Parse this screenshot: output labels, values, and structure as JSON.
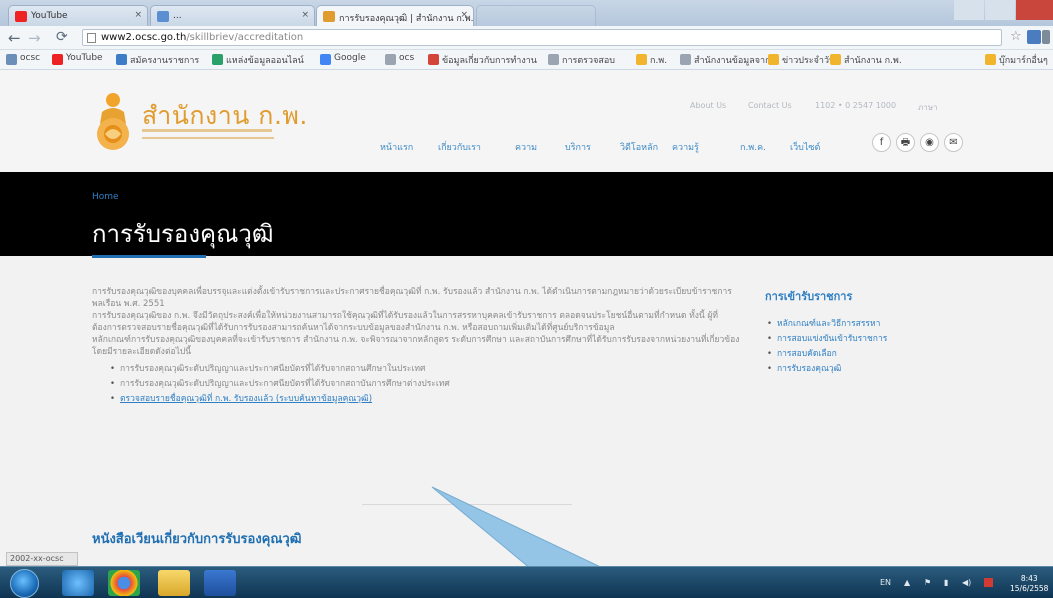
{
  "browser": {
    "tabs": [
      {
        "label": "YouTube",
        "active": false
      },
      {
        "label": "...",
        "active": false
      },
      {
        "label": "การรับรองคุณวุฒิ | สำนักงาน ก.พ.",
        "active": true
      },
      {
        "label": "",
        "active": false
      }
    ],
    "url_host": "www2.ocsc.go.th",
    "url_path": "/skillbriev/accreditation",
    "bookmarks": [
      "ocsc",
      "YouTube",
      "สมัครงานราชการ",
      "แหล่งข้อมูลออนไลน์",
      "Google",
      "ocs",
      "ข้อมูลเกี่ยวกับการทำงาน",
      "การตรวจสอบ",
      "ก.พ.",
      "สำนักงานข้อมูลจาก",
      "ข่าวประจำวัน",
      "สำนักงาน ก.พ.",
      "บุ๊กมาร์กอื่นๆ"
    ]
  },
  "site": {
    "logo_text": "สำนักงาน ก.พ.",
    "top_links": [
      "About Us",
      "Contact Us",
      "1102 • 0 2547 1000",
      "ภาษา"
    ],
    "main_nav": [
      "หน้าแรก",
      "เกี่ยวกับเรา",
      "ความ",
      "บริการ",
      "วิดีโอหลัก",
      "ความรู้",
      "ก.พ.ค.",
      "เว็บไซต์"
    ],
    "social": [
      "f",
      "🖶",
      "◉",
      "✉"
    ],
    "breadcrumb": "Home",
    "page_title": "การรับรองคุณวุฒิ",
    "paragraphs": [
      "การรับรองคุณวุฒิของบุคคลเพื่อบรรจุและแต่งตั้งเข้ารับราชการและประกาศรายชื่อคุณวุฒิที่ ก.พ. รับรองแล้ว สำนักงาน ก.พ. ได้ดำเนินการตามกฎหมายว่าด้วยระเบียบข้าราชการพลเรือน พ.ศ. 2551",
      "การรับรองคุณวุฒิของ ก.พ. จึงมีวัตถุประสงค์เพื่อให้หน่วยงานสามารถใช้คุณวุฒิที่ได้รับรองแล้วในการสรรหาบุคคลเข้ารับราชการ ตลอดจนประโยชน์อื่นตามที่กำหนด ทั้งนี้ ผู้ที่ต้องการตรวจสอบรายชื่อคุณวุฒิที่ได้รับการรับรองสามารถค้นหาได้จากระบบข้อมูลของสำนักงาน ก.พ. หรือสอบถามเพิ่มเติมได้ที่ศูนย์บริการข้อมูล",
      "หลักเกณฑ์การรับรองคุณวุฒิของบุคคลที่จะเข้ารับราชการ สำนักงาน ก.พ. จะพิจารณาจากหลักสูตร ระดับการศึกษา และสถาบันการศึกษาที่ได้รับการรับรองจากหน่วยงานที่เกี่ยวข้อง โดยมีรายละเอียดดังต่อไปนี้"
    ],
    "bullets": [
      {
        "text": "การรับรองคุณวุฒิระดับปริญญาและประกาศนียบัตรที่ได้รับจากสถานศึกษาในประเทศ",
        "link": false
      },
      {
        "text": "การรับรองคุณวุฒิระดับปริญญาและประกาศนียบัตรที่ได้รับจากสถาบันการศึกษาต่างประเทศ",
        "link": false
      },
      {
        "text": "ตรวจสอบรายชื่อคุณวุฒิที่ ก.พ. รับรองแล้ว (ระบบค้นหาข้อมูลคุณวุฒิ)",
        "link": true
      }
    ],
    "sub_heading": "หนังสือเวียนเกี่ยวกับการรับรองคุณวุฒิ",
    "sidebar_title": "การเข้ารับราชการ",
    "sidebar_items": [
      "หลักเกณฑ์และวิธีการสรรหา",
      "การสอบแข่งขันเข้ารับราชการ",
      "การสอบคัดเลือก",
      "การรับรองคุณวุฒิ"
    ],
    "status_text": "2002-xx-ocsc"
  },
  "taskbar": {
    "tray_lang": "EN",
    "clock_time": "8:43",
    "clock_date": "15/6/2558"
  },
  "colors": {
    "link_blue": "#2f7fc4",
    "logo_orange": "#e09c2f",
    "hero_black": "#000000",
    "accent_blue": "#1f6fb2"
  }
}
